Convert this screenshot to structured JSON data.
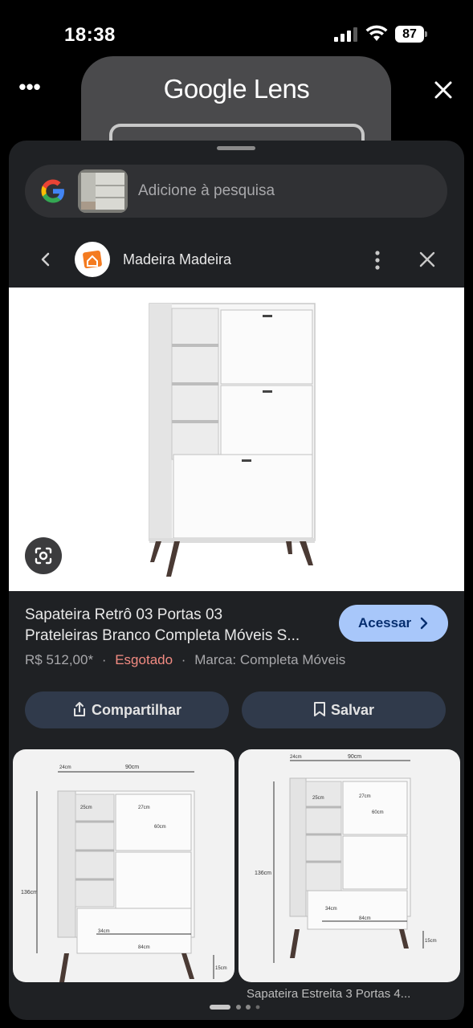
{
  "status_bar": {
    "time": "18:38",
    "battery": "87"
  },
  "header": {
    "title": "Google Lens"
  },
  "search": {
    "placeholder": "Adicione à pesquisa"
  },
  "source": {
    "name": "Madeira Madeira"
  },
  "product": {
    "title_line1": "Sapateira Retrô 03 Portas 03",
    "title_line2": "Prateleiras Branco Completa Móveis S...",
    "price": "R$ 512,00*",
    "availability": "Esgotado",
    "brand": "Marca: Completa Móveis",
    "separator": "·"
  },
  "actions": {
    "access_label": "Acessar",
    "share_label": "Compartilhar",
    "save_label": "Salvar"
  },
  "dimensions": {
    "card1": {
      "width": "90cm",
      "side": "24cm",
      "shelf": "25cm",
      "door": "27cm",
      "inner": "60cm",
      "height": "136cm",
      "lower": "34cm",
      "base": "84cm",
      "leg": "15cm"
    },
    "card2": {
      "width": "90cm",
      "side": "24cm",
      "shelf": "25cm",
      "door": "27cm",
      "inner": "60cm",
      "height": "136cm",
      "lower": "34cm",
      "base": "84cm",
      "leg": "15cm"
    }
  },
  "related": {
    "caption": "Sapateira Estreita 3 Portas 4..."
  },
  "colors": {
    "accent": "#a8c7fa",
    "sold_out": "#f28b82",
    "sheet": "#1f2124"
  }
}
